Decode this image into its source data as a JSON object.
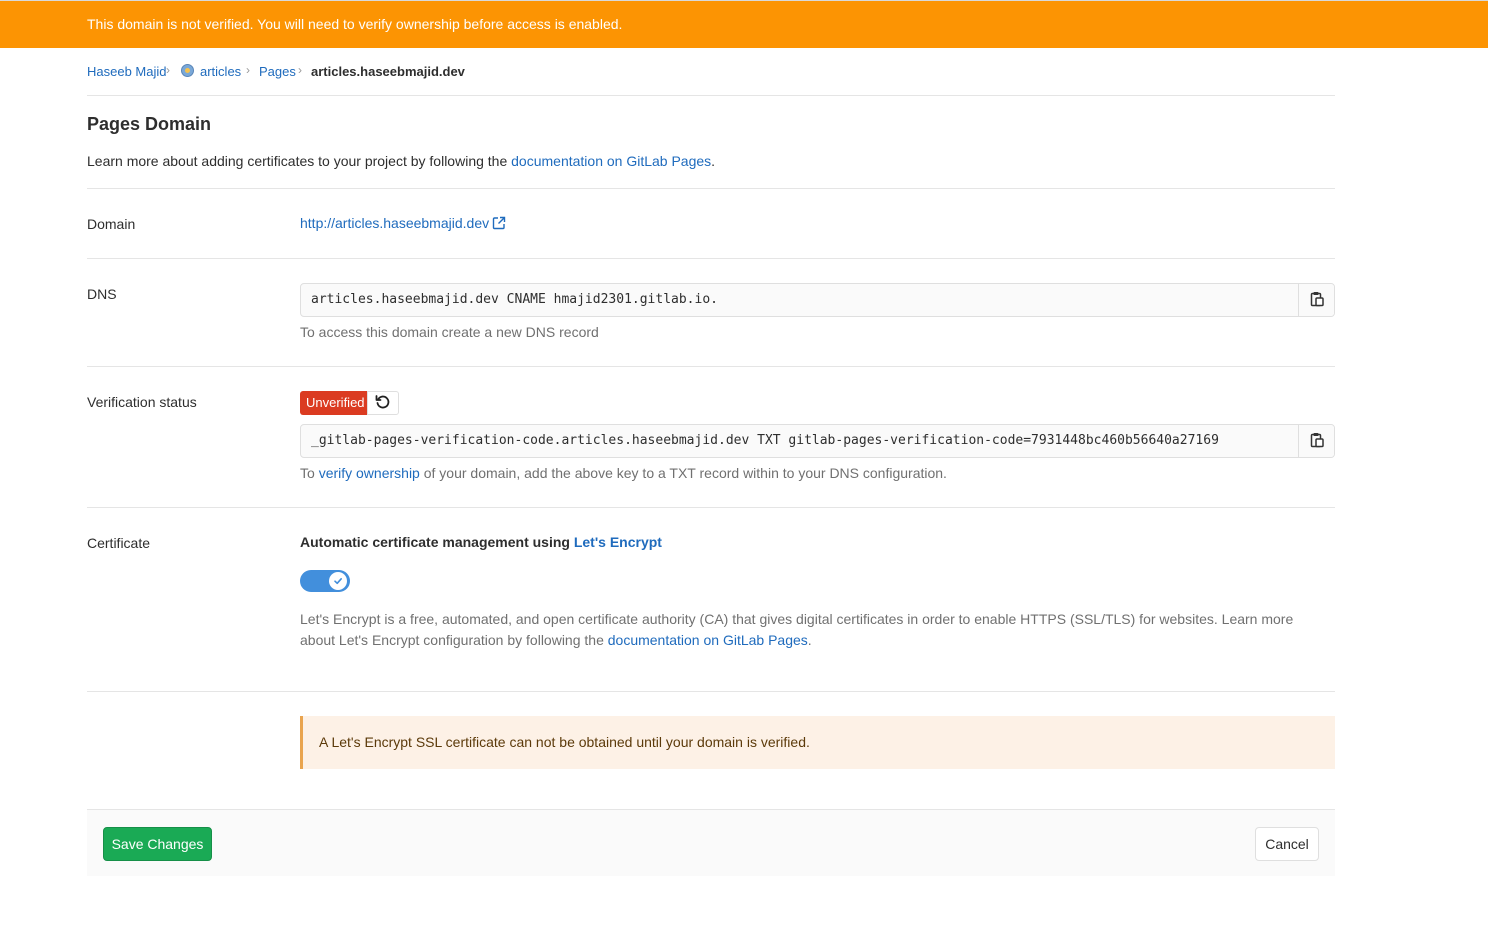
{
  "banner": {
    "text": "This domain is not verified. You will need to verify ownership before access is enabled.",
    "color": "#fc9403"
  },
  "breadcrumb": {
    "items": [
      "Haseeb Majid",
      "articles",
      "Pages"
    ],
    "current": "articles.haseebmajid.dev",
    "separator": "›"
  },
  "page": {
    "title": "Pages Domain",
    "intro_prefix": "Learn more about adding certificates to your project by following the ",
    "intro_link": "documentation on GitLab Pages",
    "intro_suffix": "."
  },
  "domain": {
    "label": "Domain",
    "url": "http://articles.haseebmajid.dev",
    "icon": "external-link-icon"
  },
  "dns": {
    "label": "DNS",
    "record": "articles.haseebmajid.dev CNAME hmajid2301.gitlab.io.",
    "help": "To access this domain create a new DNS record",
    "copy_icon": "clipboard-icon"
  },
  "verification": {
    "label": "Verification status",
    "badge": "Unverified",
    "badge_color": "#db3b21",
    "retry_icon": "retry-icon",
    "record": "_gitlab-pages-verification-code.articles.haseebmajid.dev TXT gitlab-pages-verification-code=7931448bc460b56640a27169",
    "help_prefix": "To ",
    "help_link": "verify ownership",
    "help_suffix": " of your domain, add the above key to a TXT record within to your DNS configuration.",
    "copy_icon": "clipboard-icon"
  },
  "certificate": {
    "label": "Certificate",
    "heading_prefix": "Automatic certificate management using ",
    "heading_link": "Let's Encrypt",
    "toggle_on": true,
    "toggle_color": "#428fdc",
    "desc_prefix": "Let's Encrypt is a free, automated, and open certificate authority (CA) that gives digital certificates in order to enable HTTPS (SSL/TLS) for websites. Learn more about Let's Encrypt configuration by following the ",
    "desc_link": "documentation on GitLab Pages",
    "desc_suffix": "."
  },
  "alert": {
    "text": "A Let's Encrypt SSL certificate can not be obtained until your domain is verified."
  },
  "footer": {
    "save_label": "Save Changes",
    "cancel_label": "Cancel",
    "save_color": "#1aaa55"
  }
}
